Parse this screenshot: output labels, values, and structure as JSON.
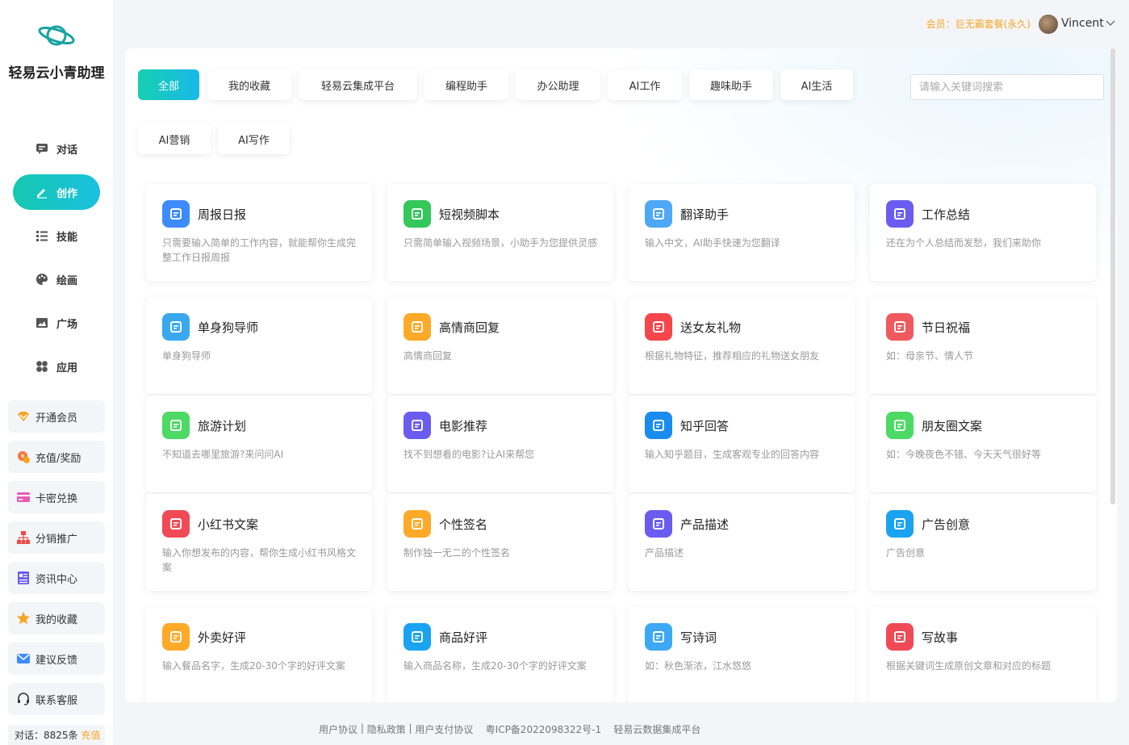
{
  "sidebar": {
    "app_name": "轻易云小青助理",
    "nav": [
      {
        "label": "对话",
        "icon": "chat-icon"
      },
      {
        "label": "创作",
        "icon": "pencil-icon"
      },
      {
        "label": "技能",
        "icon": "list-icon"
      },
      {
        "label": "绘画",
        "icon": "palette-icon"
      },
      {
        "label": "广场",
        "icon": "image-icon"
      },
      {
        "label": "应用",
        "icon": "apps-icon"
      }
    ],
    "buttons": [
      {
        "label": "开通会员",
        "icon": "vip-icon"
      },
      {
        "label": "充值/奖励",
        "icon": "coin-icon"
      },
      {
        "label": "卡密兑换",
        "icon": "card-icon"
      },
      {
        "label": "分销推广",
        "icon": "org-icon"
      },
      {
        "label": "资讯中心",
        "icon": "news-icon"
      },
      {
        "label": "我的收藏",
        "icon": "star-icon"
      },
      {
        "label": "建议反馈",
        "icon": "mail-icon"
      },
      {
        "label": "联系客服",
        "icon": "headset-icon"
      }
    ],
    "stat_label": "对话：8825条",
    "recharge_label": "充值"
  },
  "header": {
    "member_text": "会员：巨无霸套餐(永久)",
    "username": "Vincent"
  },
  "tabs": [
    "全部",
    "我的收藏",
    "轻易云集成平台",
    "编程助手",
    "办公助理",
    "AI工作",
    "趣味助手",
    "AI生活",
    "AI营销",
    "AI写作"
  ],
  "search": {
    "placeholder": "请输入关键词搜索",
    "value": ""
  },
  "cards": [
    {
      "title": "周报日报",
      "desc": "只需要输入简单的工作内容，就能帮你生成完整工作日报周报",
      "icon": "calendar-icon",
      "color": "#3d8bff"
    },
    {
      "title": "短视频脚本",
      "desc": "只需简单输入视频场景，小助手为您提供灵感",
      "icon": "video-icon",
      "color": "#34c759"
    },
    {
      "title": "翻译助手",
      "desc": "输入中文，AI助手快速为您翻译",
      "icon": "translate-icon",
      "color": "#4fa8f5"
    },
    {
      "title": "工作总结",
      "desc": "还在为个人总结而发愁，我们来助你",
      "icon": "document-icon",
      "color": "#6b5cf0"
    },
    {
      "title": "单身狗导师",
      "desc": "单身狗导师",
      "icon": "person-icon",
      "color": "#39a8ef"
    },
    {
      "title": "高情商回复",
      "desc": "高情商回复",
      "icon": "smile-icon",
      "color": "#ffa928"
    },
    {
      "title": "送女友礼物",
      "desc": "根据礼物特征，推荐相应的礼物送女朋友",
      "icon": "gift-icon",
      "color": "#f5464c"
    },
    {
      "title": "节日祝福",
      "desc": "如：母亲节、情人节",
      "icon": "greeting-icon",
      "color": "#f0595e"
    },
    {
      "title": "旅游计划",
      "desc": "不知道去哪里旅游?来问问AI",
      "icon": "checklist-icon",
      "color": "#4cd964"
    },
    {
      "title": "电影推荐",
      "desc": "找不到想看的电影?让AI来帮您",
      "icon": "film-icon",
      "color": "#6b5cf0"
    },
    {
      "title": "知乎回答",
      "desc": "输入知乎题目，生成客观专业的回答内容",
      "icon": "zhihu-icon",
      "color": "#1a8cf0"
    },
    {
      "title": "朋友圈文案",
      "desc": "如：今晚夜色不错、今天天气很好等",
      "icon": "moments-icon",
      "color": "#4cd964"
    },
    {
      "title": "小红书文案",
      "desc": "输入你想发布的内容，帮你生成小红书风格文案",
      "icon": "redbook-icon",
      "color": "#f04a56"
    },
    {
      "title": "个性签名",
      "desc": "制作独一无二的个性签名",
      "icon": "signature-icon",
      "color": "#ffa928"
    },
    {
      "title": "产品描述",
      "desc": "产品描述",
      "icon": "product-icon",
      "color": "#6b5cf0"
    },
    {
      "title": "广告创意",
      "desc": "广告创意",
      "icon": "bulb-icon",
      "color": "#1aa3f0"
    },
    {
      "title": "外卖好评",
      "desc": "输入餐品名字，生成20-30个字的好评文案",
      "icon": "scooter-icon",
      "color": "#ffa928"
    },
    {
      "title": "商品好评",
      "desc": "输入商品名称，生成20-30个字的好评文案",
      "icon": "thumb-icon",
      "color": "#1aa3f0"
    },
    {
      "title": "写诗词",
      "desc": "如：秋色渐浓，江水悠悠",
      "icon": "brush-icon",
      "color": "#3da8f5"
    },
    {
      "title": "写故事",
      "desc": "根据关键词生成原创文章和对应的标题",
      "icon": "story-icon",
      "color": "#f04a56"
    }
  ],
  "footer": {
    "links": [
      "用户协议",
      "隐私政策",
      "用户支付协议"
    ],
    "icp": "粤ICP备2022098322号-1",
    "platform": "轻易云数据集成平台"
  }
}
